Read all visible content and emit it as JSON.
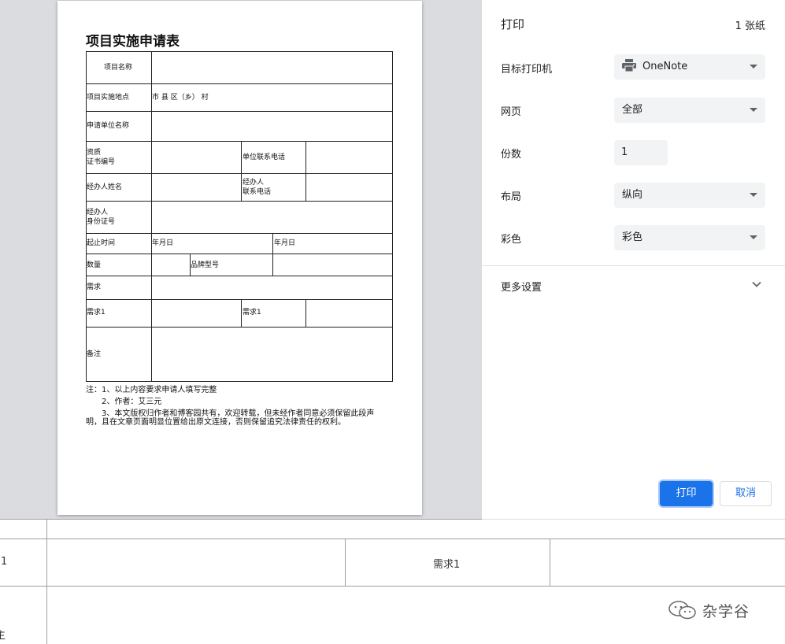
{
  "background": {
    "row_fragment_1": "1",
    "cell_xuqiu1": "需求1",
    "row_fragment_2": "主"
  },
  "preview": {
    "form_title": "项目实施申请表",
    "rows": {
      "project_name": "项目名称",
      "location": "项目实施地点",
      "location_value": "市 县 区（乡） 村",
      "applicant_unit": "申请单位名称",
      "cert_line1": "资质",
      "cert_line2": "证书编号",
      "unit_phone": "单位联系电话",
      "handler_name": "经办人姓名",
      "handler_phone_line1": "经办人",
      "handler_phone_line2": "联系电话",
      "handler_id_line1": "经办人",
      "handler_id_line2": "身份证号",
      "period": "起止时间",
      "start_date": "年月日",
      "end_date": "年月日",
      "quantity": "数量",
      "brand_model": "品牌型号",
      "demand": "需求",
      "demand1_left": "需求1",
      "demand1_right": "需求1",
      "remark": "备注"
    },
    "notes": {
      "line1": "注：1、以上内容要求申请人填写完整",
      "line2": "2、作者：艾三元",
      "line3a": "3、本文版权归作者和博客园共有，欢迎转载，但未经作者同意必须保留此段声",
      "line3b": "明，且在文章页面明显位置给出原文连接，否则保留追究法律责任的权利。"
    }
  },
  "settings": {
    "title": "打印",
    "sheet_count": "1 张纸",
    "destination_label": "目标打印机",
    "destination_value": "OneNote",
    "pages_label": "网页",
    "pages_value": "全部",
    "copies_label": "份数",
    "copies_value": "1",
    "layout_label": "布局",
    "layout_value": "纵向",
    "color_label": "彩色",
    "color_value": "彩色",
    "more_settings": "更多设置",
    "print_button": "打印",
    "cancel_button": "取消"
  },
  "watermark": {
    "text": "杂学谷"
  },
  "colors": {
    "accent": "#1a73e8",
    "preview_bg": "#dadce0",
    "select_bg": "#f1f3f4"
  }
}
